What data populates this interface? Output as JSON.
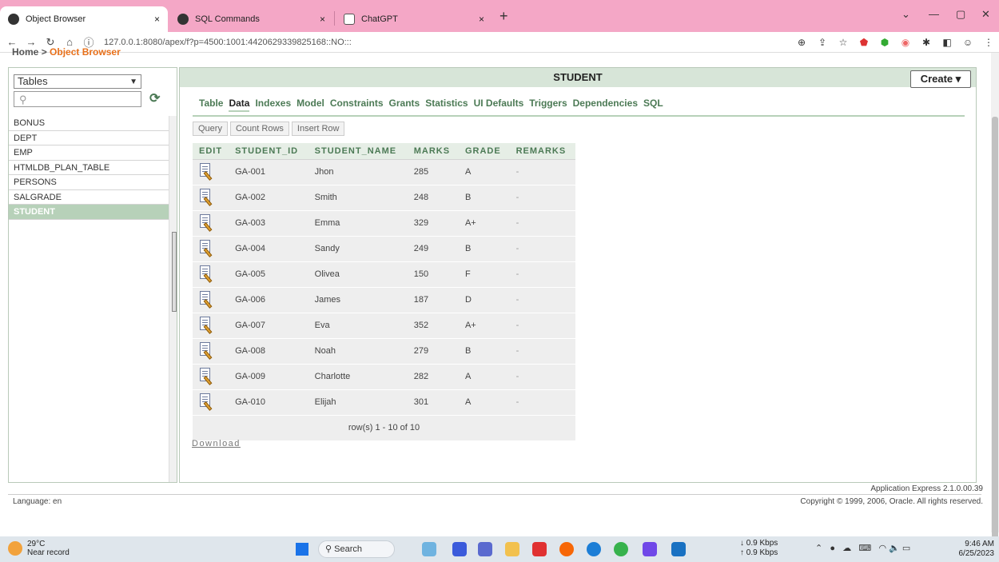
{
  "browser": {
    "tabs": [
      {
        "title": "Object Browser",
        "close": "×"
      },
      {
        "title": "SQL Commands",
        "close": "×"
      },
      {
        "title": "ChatGPT",
        "close": "×"
      }
    ],
    "new_tab": "+",
    "window": {
      "minimize": "—",
      "restore": "▢",
      "close": "✕",
      "chevron": "⌄"
    },
    "nav": {
      "back": "←",
      "forward": "→",
      "reload": "↻",
      "home": "⌂",
      "info": "ⓘ"
    },
    "url": "127.0.0.1:8080/apex/f?p=4500:1001:4420629339825168::NO:::"
  },
  "breadcrumb": {
    "home": "Home",
    "sep": ">",
    "current": "Object Browser"
  },
  "left_panel": {
    "type_selected": "Tables",
    "search_value": "",
    "objects": [
      "BONUS",
      "DEPT",
      "EMP",
      "HTMLDB_PLAN_TABLE",
      "PERSONS",
      "SALGRADE",
      "STUDENT"
    ],
    "selected": "STUDENT"
  },
  "main": {
    "title": "STUDENT",
    "create_label": "Create",
    "subtabs": [
      "Table",
      "Data",
      "Indexes",
      "Model",
      "Constraints",
      "Grants",
      "Statistics",
      "UI Defaults",
      "Triggers",
      "Dependencies",
      "SQL"
    ],
    "active_subtab": "Data",
    "buttons": [
      "Query",
      "Count Rows",
      "Insert Row"
    ],
    "table": {
      "headers": [
        "EDIT",
        "STUDENT_ID",
        "STUDENT_NAME",
        "MARKS",
        "GRADE",
        "REMARKS"
      ],
      "rows": [
        [
          "GA-001",
          "Jhon",
          "285",
          "A",
          "-"
        ],
        [
          "GA-002",
          "Smith",
          "248",
          "B",
          "-"
        ],
        [
          "GA-003",
          "Emma",
          "329",
          "A+",
          "-"
        ],
        [
          "GA-004",
          "Sandy",
          "249",
          "B",
          "-"
        ],
        [
          "GA-005",
          "Olivea",
          "150",
          "F",
          "-"
        ],
        [
          "GA-006",
          "James",
          "187",
          "D",
          "-"
        ],
        [
          "GA-007",
          "Eva",
          "352",
          "A+",
          "-"
        ],
        [
          "GA-008",
          "Noah",
          "279",
          "B",
          "-"
        ],
        [
          "GA-009",
          "Charlotte",
          "282",
          "A",
          "-"
        ],
        [
          "GA-010",
          "Elijah",
          "301",
          "A",
          "-"
        ]
      ],
      "pager": "row(s) 1 - 10 of 10"
    },
    "download_label": "Download"
  },
  "footer": {
    "language": "Language: en",
    "version": "Application Express 2.1.0.00.39",
    "copyright": "Copyright © 1999, 2006, Oracle. All rights reserved."
  },
  "taskbar": {
    "temp": "29°C",
    "weather_note": "Near record",
    "search_label": "Search",
    "net_down": "↓ 0.9 Kbps",
    "net_up": "↑ 0.9 Kbps",
    "time": "9:46 AM",
    "date": "6/25/2023"
  },
  "colors": {
    "accent_green": "#4c7a55",
    "selected_green": "#b7d1b9",
    "tabbar_pink": "#f4a7c6",
    "breadcrumb_orange": "#e8701a"
  }
}
